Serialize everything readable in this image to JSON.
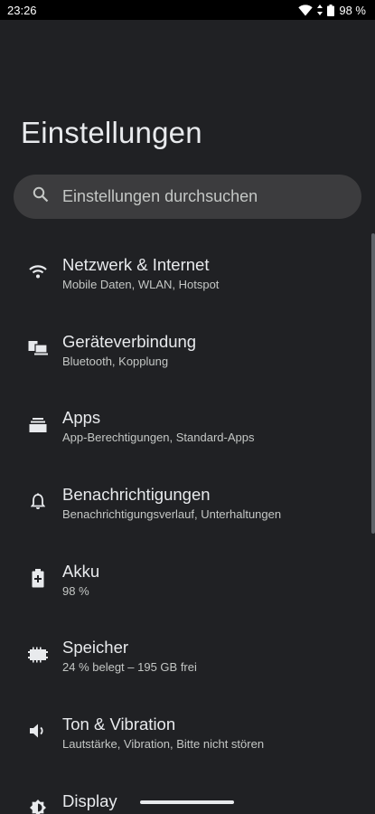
{
  "status_bar": {
    "time": "23:26",
    "battery": "98 %"
  },
  "title": "Einstellungen",
  "search": {
    "placeholder": "Einstellungen durchsuchen"
  },
  "items": [
    {
      "title": "Netzwerk & Internet",
      "subtitle": "Mobile Daten, WLAN, Hotspot",
      "icon": "wifi-icon"
    },
    {
      "title": "Geräteverbindung",
      "subtitle": "Bluetooth, Kopplung",
      "icon": "devices-icon"
    },
    {
      "title": "Apps",
      "subtitle": "App-Berechtigungen, Standard-Apps",
      "icon": "apps-icon"
    },
    {
      "title": "Benachrichtigungen",
      "subtitle": "Benachrichtigungsverlauf, Unterhaltungen",
      "icon": "bell-icon"
    },
    {
      "title": "Akku",
      "subtitle": "98 %",
      "icon": "battery-icon"
    },
    {
      "title": "Speicher",
      "subtitle": "24 % belegt – 195 GB frei",
      "icon": "storage-icon"
    },
    {
      "title": "Ton & Vibration",
      "subtitle": "Lautstärke, Vibration, Bitte nicht stören",
      "icon": "speaker-icon"
    },
    {
      "title": "Display",
      "subtitle": "",
      "icon": "brightness-icon"
    }
  ],
  "colors": {
    "background": "#202124",
    "search_bg": "#3c3c3e",
    "text": "#e8eaed",
    "subtext": "#c4c7c5"
  }
}
